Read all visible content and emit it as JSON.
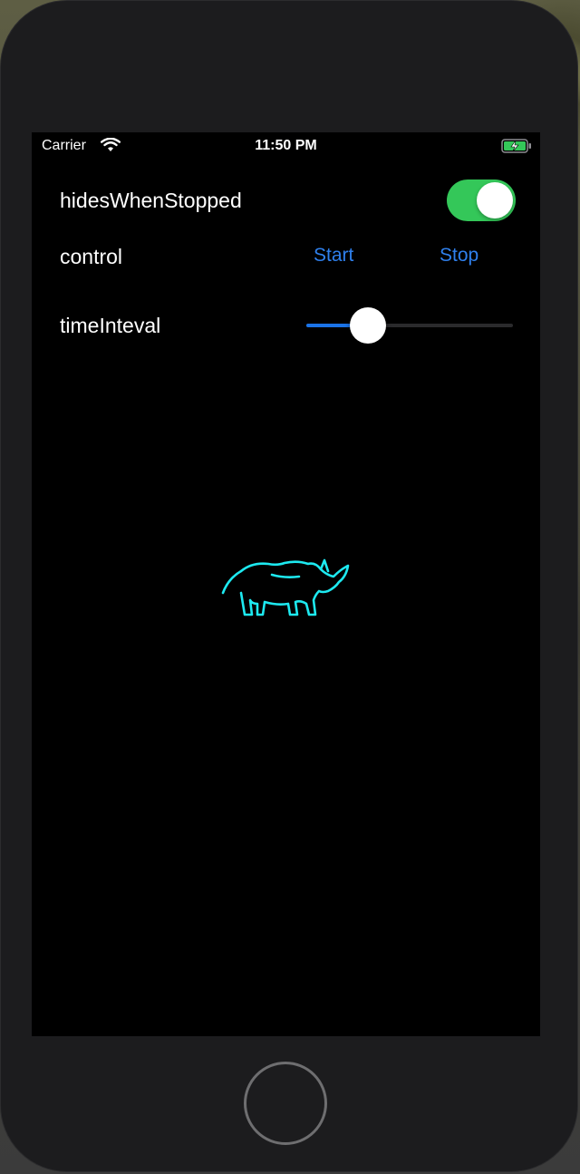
{
  "status_bar": {
    "carrier": "Carrier",
    "time": "11:50 PM",
    "wifi_icon": "wifi-icon",
    "battery_icon": "battery-charging-icon"
  },
  "rows": {
    "hides_label": "hidesWhenStopped",
    "control_label": "control",
    "time_label": "timeInteval"
  },
  "toggle": {
    "on": true,
    "color": "#34c759"
  },
  "buttons": {
    "start": "Start",
    "stop": "Stop",
    "color": "#2f80ed"
  },
  "slider": {
    "value": 0.3,
    "fill_color": "#1a73e8"
  },
  "activity_indicator": {
    "icon": "rhino-icon",
    "color": "#1de9f0"
  },
  "home_button": {
    "icon": "home-button"
  }
}
